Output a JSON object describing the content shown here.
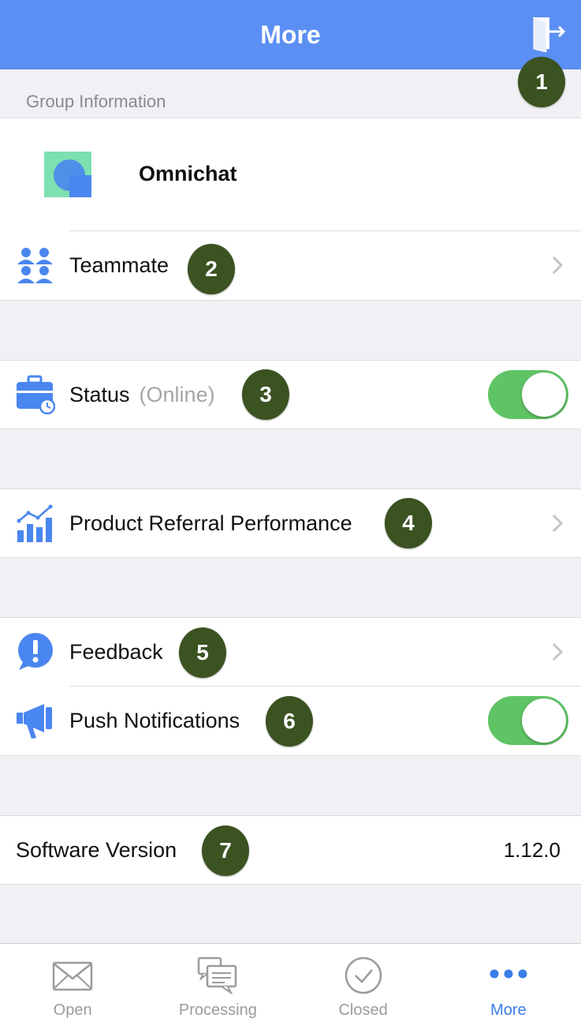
{
  "header": {
    "title": "More"
  },
  "group": {
    "section_label": "Group Information",
    "name": "Omnichat"
  },
  "rows": {
    "teammate": {
      "label": "Teammate"
    },
    "status": {
      "label": "Status",
      "sub": "(Online)",
      "enabled": true
    },
    "referral": {
      "label": "Product Referral Performance"
    },
    "feedback": {
      "label": "Feedback"
    },
    "push": {
      "label": "Push Notifications",
      "enabled": true
    },
    "version": {
      "label": "Software Version",
      "value": "1.12.0"
    }
  },
  "markers": [
    "1",
    "2",
    "3",
    "4",
    "5",
    "6",
    "7"
  ],
  "tabs": [
    {
      "label": "Open",
      "icon": "envelope-icon"
    },
    {
      "label": "Processing",
      "icon": "chat-bubbles-icon"
    },
    {
      "label": "Closed",
      "icon": "check-circle-icon"
    },
    {
      "label": "More",
      "icon": "more-dots-icon",
      "active": true
    }
  ],
  "colors": {
    "header": "#5b8ff3",
    "toggle_on": "#5fc465",
    "tab_active": "#3a7de8",
    "marker": "#3b5221"
  }
}
